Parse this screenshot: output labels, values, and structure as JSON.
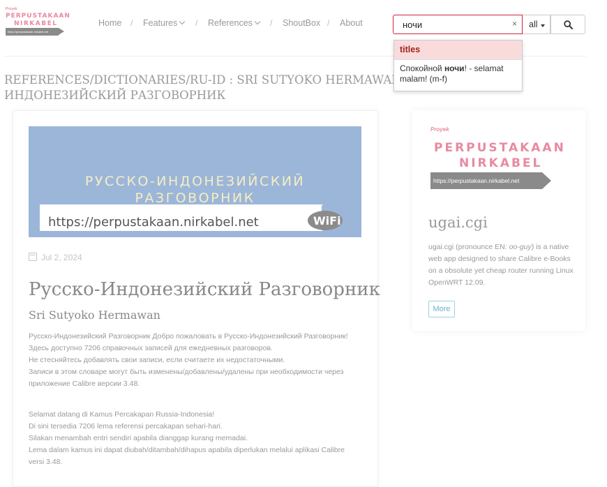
{
  "logo": {
    "small": "Proyek",
    "line1": "PERPUSTAKAAN",
    "line2": "NIRKABEL",
    "url": "https://perpustakaan.nirkabel.net"
  },
  "nav": {
    "items": [
      {
        "label": "Home"
      },
      {
        "label": "Features"
      },
      {
        "label": "References"
      },
      {
        "label": "ShoutBox"
      },
      {
        "label": "About"
      }
    ],
    "separator": "/"
  },
  "search": {
    "value": "ночи",
    "clear": "×",
    "category": "all"
  },
  "autocomplete": {
    "header": "titles",
    "item_prefix": "Спокойной ",
    "item_match": "ночи",
    "item_suffix": "! - selamat malam! (m-f)"
  },
  "page_title": "REFERENCES/DICTIONARIES/RU-ID : SRI SUTYOKO HERMAWAN :: РУССКО-ИНДОНЕЗИЙСКИЙ РАЗГОВОРНИК",
  "book": {
    "cover_line1": "РУССКО-ИНДОНЕЗИЙСКИЙ",
    "cover_line2": "РАЗГОВОРНИК",
    "cover_url": "https://perpustakaan.nirkabel.net",
    "cover_badge": "WiFi",
    "date": "Jul 2, 2024",
    "title": "Русско-Индонезийский Разговорник",
    "author": "Sri Sutyoko Hermawan",
    "desc_ru": [
      "Русско-Индонезийский Разговорник Добро пожаловать в Русско-Индонезийский Разговорник!",
      "Здесь доступно 7206 справочных записей для ежедневных разговоров.",
      "Не стесняйтесь добавлять свои записи, если считаете их недостаточными.",
      "Записи в этом словаре могут быть изменены/добавлены/удалены при необходимости через приложение Calibre версии 3.48."
    ],
    "desc_id": [
      "Selamat datang di Kamus Percakapan Russia-Indonesia!",
      "Di sini tersedia 7206 lema referensi percakapan sehari-hari.",
      "Silakan menambah entri sendiri apabila dianggap kurang memadai.",
      "Lema dalam kamus ini dapat diubah/ditambah/dihapus apabila diperlukan melalui aplikasi Calibre versi 3.48."
    ]
  },
  "sidebar": {
    "logo_small": "Proyek",
    "logo_line1": "PERPUSTAKAAN",
    "logo_line2": "NIRKABEL",
    "logo_url": "https://perpustakaan.nirkabel.net",
    "title": "ugai.cgi",
    "desc_a": "ugai.cgi (pronounce EN: ",
    "desc_em": "oo-guy",
    "desc_b": ") is a native web app designed to share Calibre e-Books on a obsolute yet cheap router running Linux OpenWRT 12.09.",
    "more": "More"
  },
  "colors": {
    "accent": "#c9283e",
    "brand_pink": "#e88aa0",
    "link_blue": "#6ab0d2",
    "cover_bg": "#9cb6da"
  }
}
